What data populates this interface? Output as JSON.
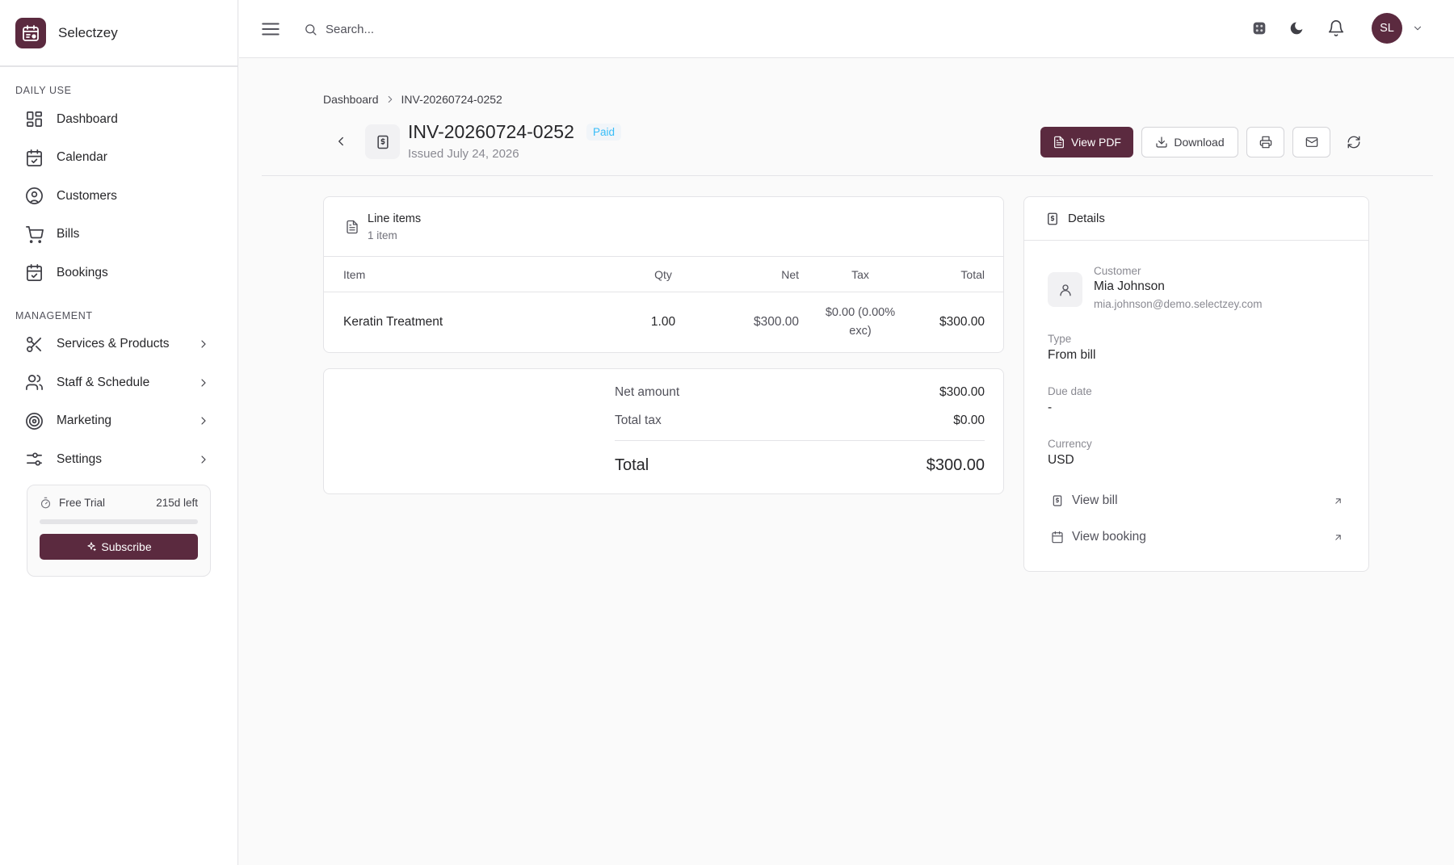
{
  "app": {
    "name": "Selectzey"
  },
  "sidebar": {
    "sections": [
      {
        "label": "DAILY USE",
        "items": [
          {
            "label": "Dashboard",
            "icon": "layout-grid-icon"
          },
          {
            "label": "Calendar",
            "icon": "calendar-check-icon"
          },
          {
            "label": "Customers",
            "icon": "user-circle-icon"
          },
          {
            "label": "Bills",
            "icon": "shopping-cart-icon"
          },
          {
            "label": "Bookings",
            "icon": "calendar-check-icon"
          }
        ]
      },
      {
        "label": "MANAGEMENT",
        "items": [
          {
            "label": "Services & Products",
            "icon": "scissors-icon"
          },
          {
            "label": "Staff & Schedule",
            "icon": "users-icon"
          },
          {
            "label": "Marketing",
            "icon": "target-icon"
          },
          {
            "label": "Settings",
            "icon": "sliders-icon"
          }
        ]
      }
    ],
    "trial": {
      "label": "Free Trial",
      "remaining": "215d left",
      "progress": 0.0,
      "button": "Subscribe"
    }
  },
  "topbar": {
    "search_placeholder": "Search...",
    "avatar_initials": "SL"
  },
  "breadcrumb": {
    "parent": "Dashboard",
    "current": "INV-20260724-0252"
  },
  "invoice": {
    "number": "INV-20260724-0252",
    "status": "Paid",
    "issued": "Issued July 24, 2026"
  },
  "actions": {
    "view_pdf": "View PDF",
    "download": "Download"
  },
  "line_items": {
    "title": "Line items",
    "count": "1 item",
    "columns": {
      "item": "Item",
      "qty": "Qty",
      "net": "Net",
      "tax": "Tax",
      "total": "Total"
    },
    "rows": [
      {
        "item": "Keratin Treatment",
        "qty": "1.00",
        "net": "$300.00",
        "tax_line1": "$0.00 (0.00%",
        "tax_line2": "exc)",
        "total": "$300.00"
      }
    ]
  },
  "summary": {
    "net_label": "Net amount",
    "net_value": "$300.00",
    "tax_label": "Total tax",
    "tax_value": "$0.00",
    "total_label": "Total",
    "total_value": "$300.00"
  },
  "details": {
    "title": "Details",
    "customer_label": "Customer",
    "customer_name": "Mia Johnson",
    "customer_email": "mia.johnson@demo.selectzey.com",
    "type_label": "Type",
    "type_value": "From bill",
    "due_label": "Due date",
    "due_value": "-",
    "currency_label": "Currency",
    "currency_value": "USD",
    "view_bill": "View bill",
    "view_booking": "View booking"
  }
}
